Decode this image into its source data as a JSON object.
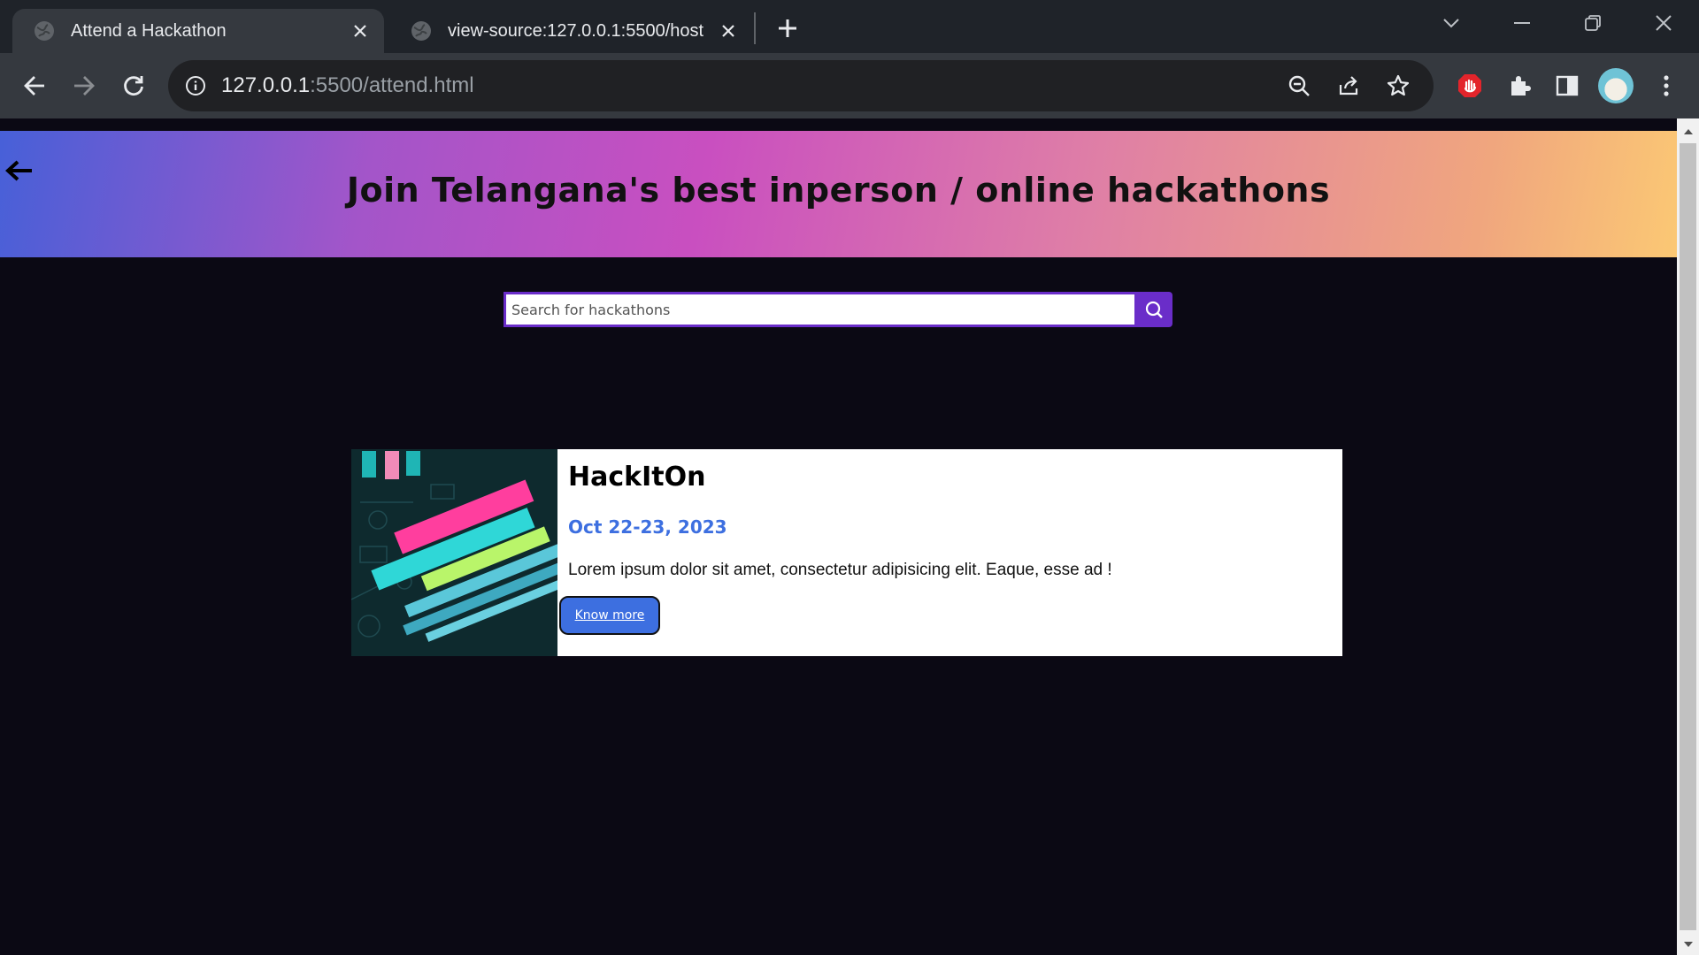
{
  "browser": {
    "tabs": [
      {
        "title": "Attend a Hackathon",
        "active": true
      },
      {
        "title": "view-source:127.0.0.1:5500/host",
        "active": false
      }
    ],
    "url_host": "127.0.0.1",
    "url_path": ":5500/attend.html"
  },
  "hero": {
    "title": "Join Telangana's best inperson / online hackathons"
  },
  "search": {
    "placeholder": "Search for hackathons"
  },
  "cards": [
    {
      "title": "HackItOn",
      "date": "Oct 22-23, 2023",
      "description": "Lorem ipsum dolor sit amet, consectetur adipisicing elit. Eaque, esse ad !",
      "button_label": "Know more"
    }
  ],
  "colors": {
    "accent_purple": "#6a2dc9",
    "accent_blue": "#3d6fe0",
    "page_bg": "#0b0914"
  }
}
